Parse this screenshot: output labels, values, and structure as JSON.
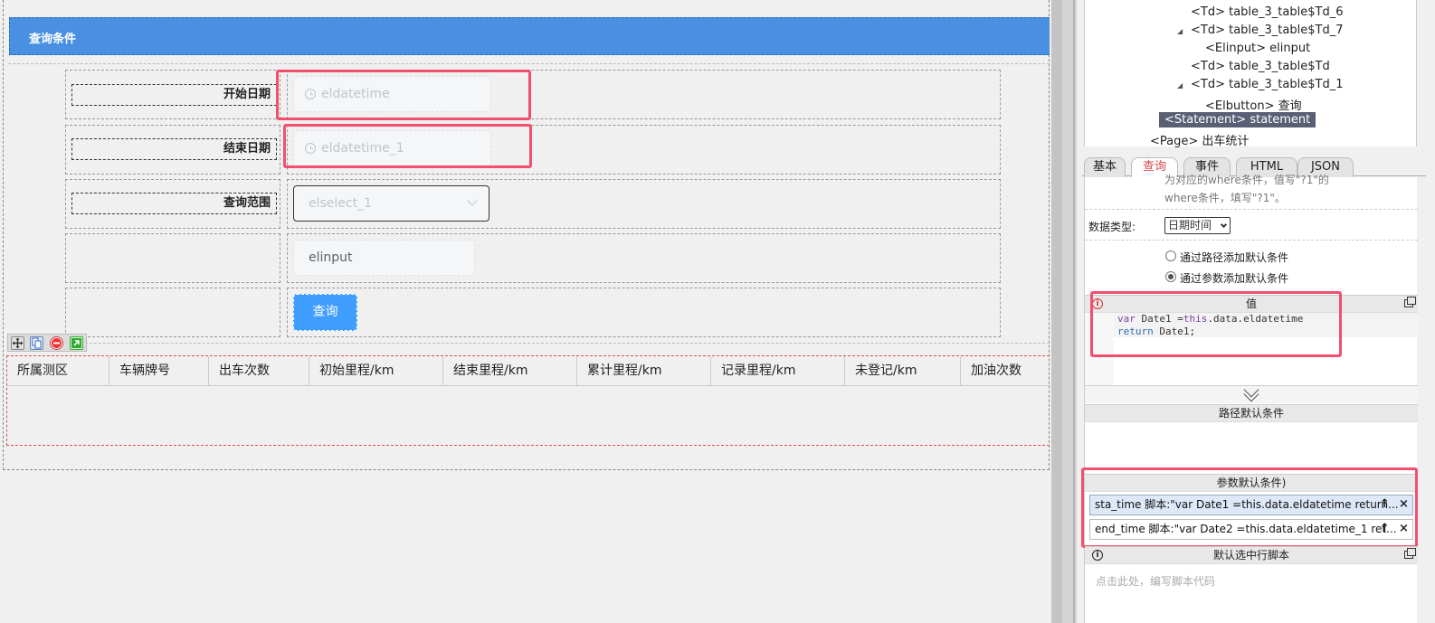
{
  "designer": {
    "query_panel_title": "查询条件",
    "fields": [
      {
        "label": "开始日期",
        "placeholder": "eldatetime"
      },
      {
        "label": "结束日期",
        "placeholder": "eldatetime_1"
      },
      {
        "label": "查询范围",
        "placeholder": "elselect_1"
      },
      {
        "label": "",
        "value": "elinput"
      }
    ],
    "query_button": "查询",
    "table_headers": [
      "所属测区",
      "车辆牌号",
      "出车次数",
      "初始里程/km",
      "结束里程/km",
      "累计里程/km",
      "记录里程/km",
      "未登记/km",
      "加油次数"
    ]
  },
  "tree": {
    "nodes": [
      "<Td> table_3_table$Td_6",
      "<Td> table_3_table$Td_7",
      "<Elinput> elinput",
      "<Td> table_3_table$Td",
      "<Td> table_3_table$Td_1",
      "<Elbutton> 查询",
      "<Statement> statement",
      "<Page> 出车统计"
    ]
  },
  "tabs": [
    "基本",
    "查询",
    "事件",
    "HTML",
    "JSON"
  ],
  "props": {
    "hint_line1": "为对应的where条件，值写\"?1\"的",
    "hint_line2": "where条件，填写\"?1\"。",
    "data_type_label": "数据类型:",
    "data_type_value": "日期时间",
    "radio_path": "通过路径添加默认条件",
    "radio_param": "通过参数添加默认条件",
    "value_section": "值",
    "code_line1_kw": "var",
    "code_line1_rest": " Date1 =",
    "code_line1_this": "this",
    "code_line1_tail": ".data.eldatetime",
    "code_line2_kw": "return",
    "code_line2_rest": " Date1;",
    "path_section": "路径默认条件",
    "param_section": "参数默认条件)",
    "conditions": [
      "sta_time 脚本:\"var Date1 =this.data.eldatetime return...",
      "end_time 脚本:\"var Date2 =this.data.eldatetime_1 ret..."
    ],
    "up_symbol": "↑",
    "close_symbol": "×",
    "default_row_section": "默认选中行脚本",
    "script_placeholder": "点击此处，编写脚本代码"
  }
}
